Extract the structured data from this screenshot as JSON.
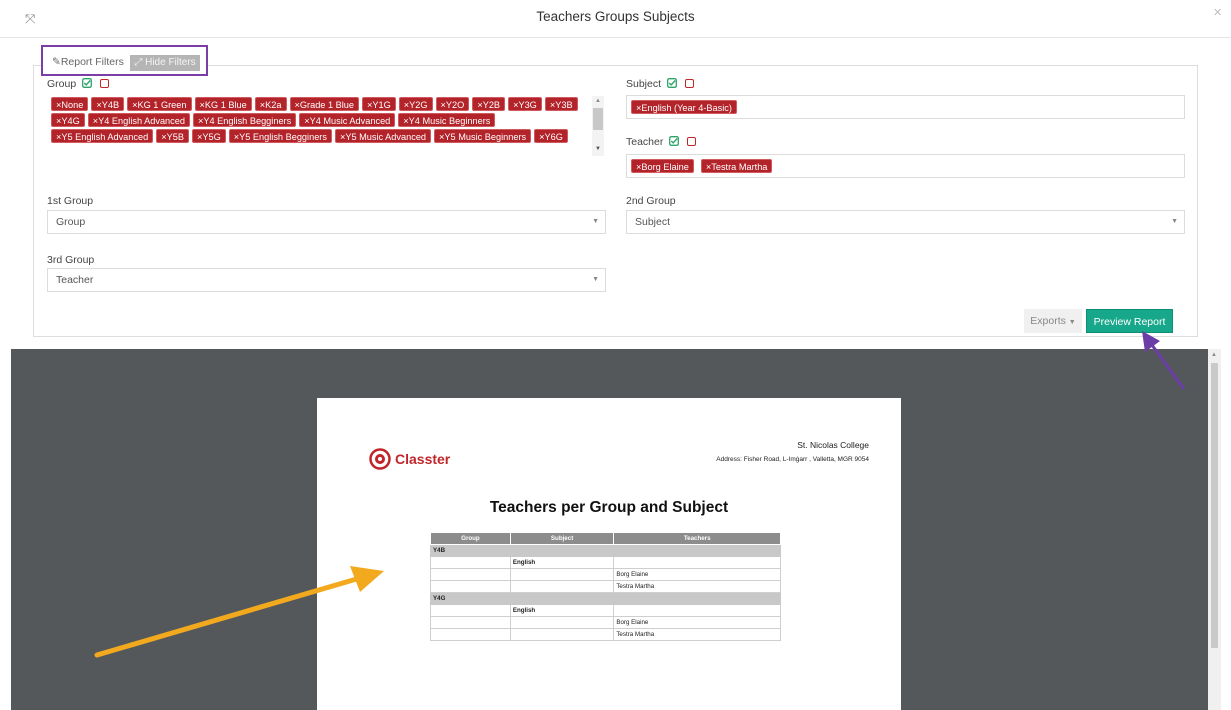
{
  "modal": {
    "title": "Teachers Groups Subjects"
  },
  "filters": {
    "report_filters_label": "Report Filters",
    "hide_filters_label": "Hide Filters",
    "group": {
      "label": "Group",
      "tags": [
        "None",
        "Y4B",
        "KG 1 Green",
        "KG 1 Blue",
        "K2a",
        "Grade 1 Blue",
        "Y1G",
        "Y2G",
        "Y2O",
        "Y2B",
        "Y3G",
        "Y3B",
        "Y4G",
        "Y4 English Advanced",
        "Y4 English Begginers",
        "Y4 Music Advanced",
        "Y4 Music Beginners",
        "Y5 English Advanced",
        "Y5B",
        "Y5G",
        "Y5 English Begginers",
        "Y5 Music Advanced",
        "Y5 Music Beginners",
        "Y6G"
      ]
    },
    "subject": {
      "label": "Subject",
      "tags": [
        "English (Year 4-Basic)"
      ]
    },
    "teacher": {
      "label": "Teacher",
      "tags": [
        "Borg Elaine",
        "Testra Martha"
      ]
    },
    "first_group": {
      "label": "1st Group",
      "value": "Group"
    },
    "second_group": {
      "label": "2nd Group",
      "value": "Subject"
    },
    "third_group": {
      "label": "3rd Group",
      "value": "Teacher"
    },
    "exports_label": "Exports",
    "preview_report_label": "Preview Report"
  },
  "report": {
    "logo_text": "Classter",
    "school_name": "St. Nicolas College",
    "school_address": "Address: Fisher Road, L-Imġarr , Valletta, MGR 9054",
    "title": "Teachers per Group and Subject",
    "columns": [
      "Group",
      "Subject",
      "Teachers"
    ],
    "groups": [
      {
        "name": "Y4B",
        "subject": "English",
        "teachers": [
          "Borg Elaine",
          "Testra Martha"
        ]
      },
      {
        "name": "Y4G",
        "subject": "English",
        "teachers": [
          "Borg Elaine",
          "Testra Martha"
        ]
      }
    ]
  },
  "colors": {
    "tag": "#b2232a",
    "primary_button": "#17a78a",
    "highlight_box": "#7b3ea6",
    "orange_arrow": "#f2a91e",
    "purple_arrow": "#6a3ea6"
  }
}
